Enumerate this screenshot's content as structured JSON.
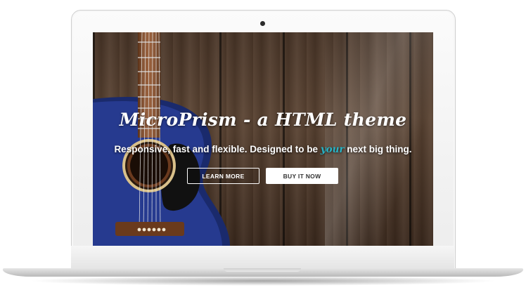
{
  "hero": {
    "title": "MicroPrism - a HTML theme",
    "subtitle_before": "Responsive, fast and flexible. Designed to be ",
    "subtitle_accent": "your",
    "subtitle_after": " next big thing.",
    "accent_color": "#26b3c6"
  },
  "buttons": {
    "learn_more": "LEARN MORE",
    "buy_it_now": "BUY IT NOW"
  },
  "icons": {
    "camera": "camera-dot",
    "guitar": "acoustic-guitar-image"
  }
}
